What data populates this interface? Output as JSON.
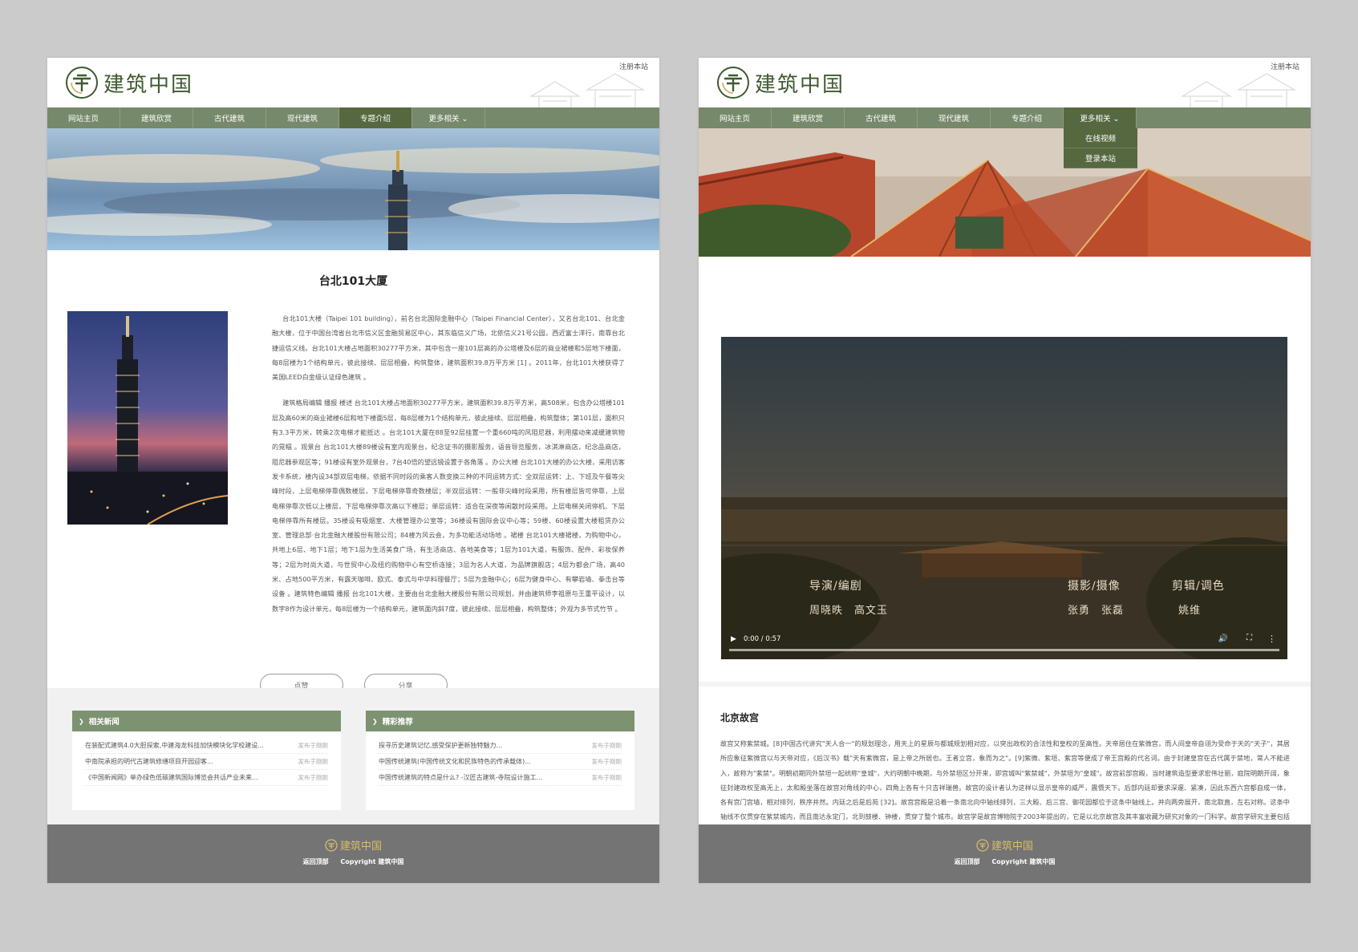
{
  "site": {
    "logo_text": "建筑中国",
    "register_link": "注册本站",
    "nav": [
      "网站主页",
      "建筑欣赏",
      "古代建筑",
      "现代建筑",
      "专题介绍",
      "更多相关 ⌄"
    ],
    "footer_logo_text": "建筑中国",
    "footer_back_top": "返回顶部",
    "footer_copyright": "Copyright 建筑中国"
  },
  "left_page": {
    "active_nav_index": 4,
    "article_title": "台北101大厦",
    "paragraph_1": "台北101大楼（Taipei 101 building），前名台北国际金融中心（Taipei Financial Center），又名台北101、台北金融大楼，位于中国台湾省台北市信义区金融贸易区中心，其东临信义广场，北依信义21号公园，西近富士洋行，南靠台北捷运信义线。台北101大楼占地面积30277平方米，其中包含一座101层高的办公塔楼及6层的商业裙楼和5层地下楼面，每8层楼为1个结构单元，彼此接续、层层相叠，构筑整体，建筑面积39.8万平方米 [1] 。2011年，台北101大楼获得了美国LEED白金级认证绿色建筑 。",
    "paragraph_2": "建筑格局编辑 播报 楼述 台北101大楼占地面积30277平方米，建筑面积39.8万平方米，高508米，包含办公塔楼101层及高60米的商业裙楼6层和地下楼面5层，每8层楼为1个结构单元，彼此接续、层层相叠，构筑整体；第101层，面积只有3.3平方米，转乘2次电梯才能抵达 。台北101大厦在88至92层挂置一个重660吨的风阻尼器，利用摆动来减缓建筑物的晃幅 。观景台 台北101大楼89楼设有室内观景台，纪念证书的摄影服务，语音导览服务，冰淇淋商店，纪念品商店，阻尼器参观区等；91楼设有室外观景台，7台40倍的望远镜设置于各角落 。办公大楼 台北101大楼的办公大楼，采用访客发卡系统，楼内设34部双层电梯，依据不同时段的乘客人数变换三种的不同运转方式：全双层运转：上、下班及午餐等尖峰时段，上层电梯停靠偶数楼层，下层电梯停靠奇数楼层；半双层运转：一般非尖峰时段采用，所有楼层皆可停靠，上层电梯停靠次低以上楼层，下层电梯停靠次高以下楼层；单层运转：适合在深夜等闲散时段采用。上层电梯关闭停机、下层电梯停靠所有楼层。35楼设有吸烟室、大楼管理办公室等；36楼设有国际会议中心等；59楼、60楼设置大楼租赁办公室、管理总部·台北金融大楼股份有限公司；84楼为风云会，为多功能活动场地 。裙楼 台北101大楼裙楼，为购物中心，共地上6层、地下1层；地下1层为生活美食广场，有生活商店、各地美食等；1层为101大道，有服饰、配件、彩妆保养等；2层为时尚大道，与世贸中心及纽约购物中心有空桥连接；3层为名人大道，为品牌旗舰店；4层为都会广场，高40米、占地500平方米，有露天咖啡、欧式、泰式与中华料理餐厅；5层为金融中心；6层为健身中心、有攀岩墙、拳击台等设备 。建筑特色编辑 播报 台北101大楼，主要由台北金融大楼股份有限公司规划，并由建筑师李祖原与王重平设计，以数字8作为设计单元，每8层楼为一个结构单元，建筑面内斜7度，彼此接续、层层相叠，构筑整体；外观为多节式竹节 。",
    "like_button": "点赞",
    "share_button": "分享",
    "related_news": {
      "title": "相关新闻",
      "items": [
        {
          "text": "在装配式建筑4.0大胆探索,中建海龙科技加快模块化学校建设...",
          "date": "发布于刚刚"
        },
        {
          "text": "中南院承担的明代古建筑修缮项目开园迎客...",
          "date": "发布于刚刚"
        },
        {
          "text": "《中国新闻网》举办绿色低碳建筑国际博览会共话产业未来...",
          "date": "发布于刚刚"
        }
      ]
    },
    "recommended": {
      "title": "精彩推荐",
      "items": [
        {
          "text": "探寻历史建筑记忆,感受保护更新独特魅力...",
          "date": "发布于刚刚"
        },
        {
          "text": "中国传统建筑(中国传统文化和民族特色的传承载体)...",
          "date": "发布于刚刚"
        },
        {
          "text": "中国传统建筑的特点是什么? -汉匠古建筑-寺院设计施工...",
          "date": "发布于刚刚"
        }
      ]
    }
  },
  "right_page": {
    "active_nav_index": 5,
    "dropdown": [
      "在线视频",
      "登录本站"
    ],
    "video": {
      "credit_director_label": "导演/编剧",
      "credit_director_names": "周晓昳　高文玉",
      "credit_camera_label": "摄影/摄像",
      "credit_camera_names": "张勇　张磊",
      "credit_editor_label": "剪辑/调色",
      "credit_editor_names": "姚维",
      "time": "0:00 / 0:57"
    },
    "section_title": "北京故宫",
    "section_text": "故宫又称紫禁城。[8]中国古代讲究\"天人合一\"的规划理念，用天上的星辰与都城规划相对应，以突出政权的合法性和皇权的至高性。天帝居住在紫微宫，而人间皇帝自诩为受命于天的\"天子\"，其居所应象征紫微宫以与天帝对应，《后汉书》载\"天有紫微宫，是上帝之所居也。王者立宫，象而为之\"。[9]紫微、紫垣、紫宫等便成了帝王宫殿的代名词。由于封建皇宫在古代属于禁地，常人不能进入，故称为\"紫禁\"。明朝初期同外禁垣一起统称\"皇城\"，大约明朝中晚期，与外禁垣区分开来，即宫城叫\"紫禁城\"，外禁垣为\"皇城\"。故宫前部宫殿，当时建筑造型要求宏伟壮丽，庭院明朗开阔，象征封建政权至高无上，太和殿坐落在故宫对角线的中心，四角上各有十只吉祥瑞兽。故宫的设计者认为这样以显示皇帝的威严，震慑天下。后部内廷却要求深邃、紧凑，因此东西六宫都自成一体，各有宫门宫墙，相对排列，秩序井然。内廷之后是后苑 [32]。故宫宫殿是沿着一条南北向中轴线排列，三大殿、后三宫、御花园都位于这条中轴线上。并向两旁展开，南北取直，左右对称。这条中轴线不仅贯穿在紫禁城内，而且南达永定门，北到鼓楼、钟楼，贯穿了整个城市。故宫学是故宫博物院于2003年提出的，它是以北京故宫及其丰富收藏为研究对象的一门科学。故宫学研究主要包括故宫宫殿建筑群、文物典藏、宫廷历史文化遗存、明清档案、清宫典籍及故宫博物院的历史六个方面，有着丰富深厚的学科内涵。故宫文化是以皇帝、皇权、皇宫为核心的皇家文化。故宫学的提出并确立将使其研究进入自觉阶段，从整体上提高故宫学研究的水平。"
  }
}
